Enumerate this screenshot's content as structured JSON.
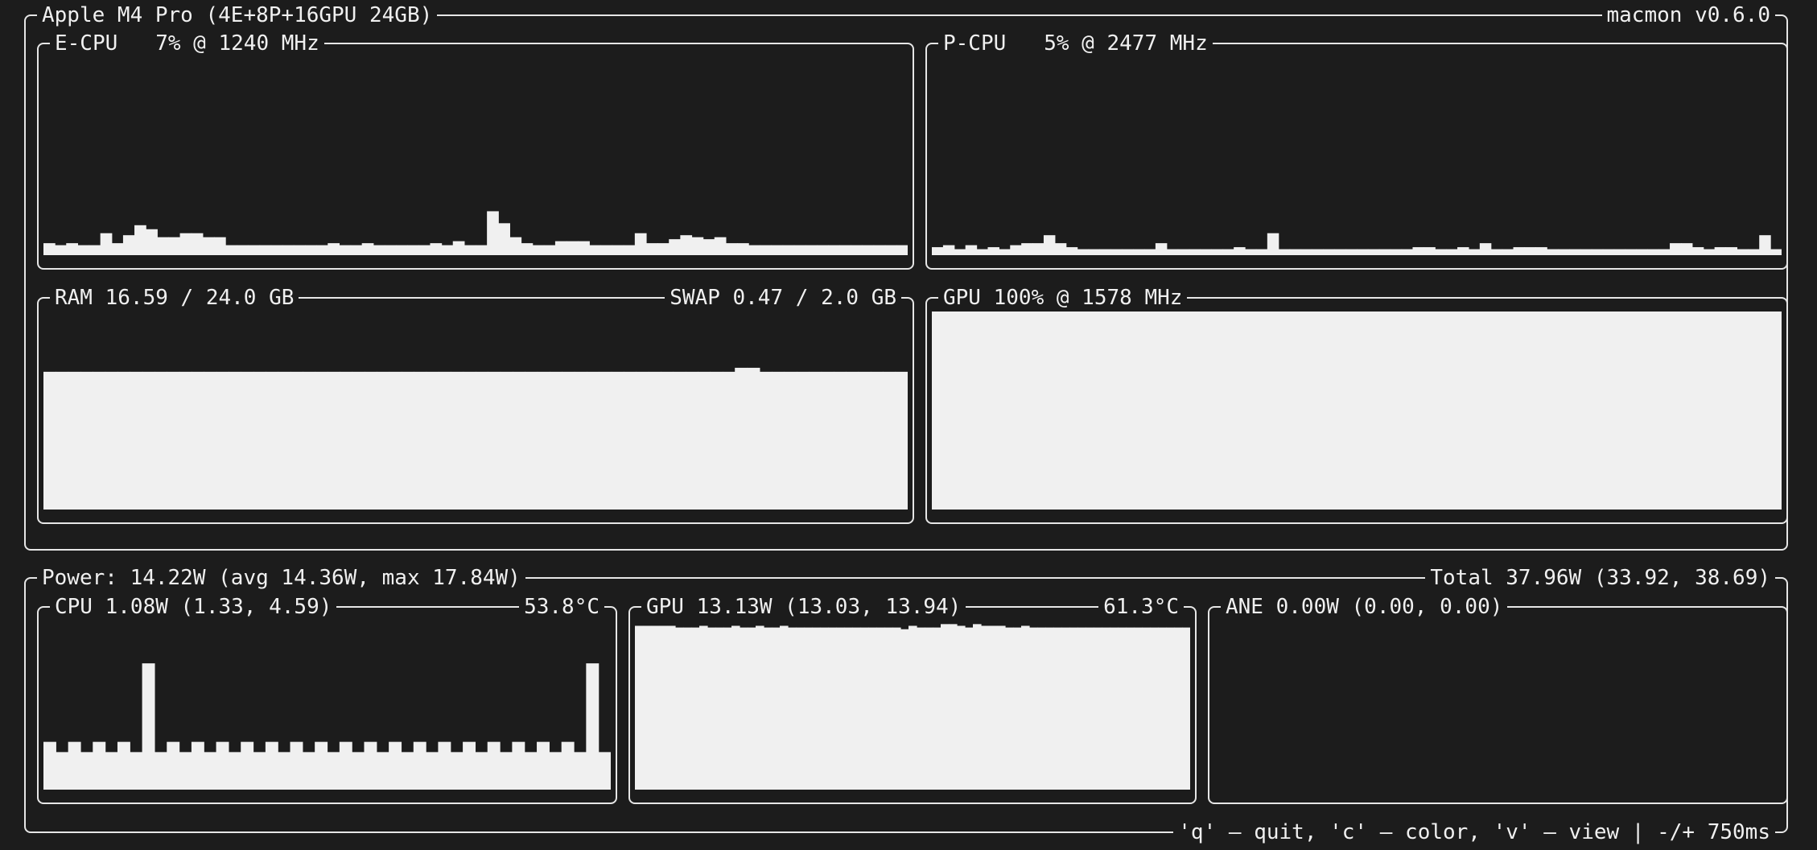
{
  "system": {
    "title": "Apple M4 Pro (4E+8P+16GPU 24GB)",
    "version": "macmon v0.6.0"
  },
  "ecpu": {
    "label": "E-CPU   7% @ 1240 MHz",
    "values": [
      6,
      5,
      6,
      5,
      5,
      11,
      6,
      10,
      15,
      13,
      9,
      9,
      11,
      11,
      9,
      9,
      5,
      5,
      5,
      5,
      5,
      5,
      5,
      5,
      5,
      6,
      5,
      5,
      6,
      5,
      5,
      5,
      5,
      5,
      6,
      5,
      7,
      5,
      5,
      22,
      16,
      9,
      6,
      5,
      5,
      7,
      7,
      7,
      5,
      5,
      5,
      5,
      11,
      6,
      6,
      8,
      10,
      9,
      8,
      9,
      6,
      6,
      5,
      5,
      5,
      5,
      5,
      5,
      5,
      5,
      5,
      5,
      5,
      5,
      5,
      5
    ]
  },
  "pcpu": {
    "label": "P-CPU   5% @ 2477 MHz",
    "values": [
      4,
      5,
      3,
      5,
      3,
      4,
      3,
      5,
      6,
      6,
      10,
      6,
      4,
      3,
      3,
      3,
      3,
      3,
      3,
      3,
      6,
      3,
      3,
      3,
      3,
      3,
      3,
      4,
      3,
      3,
      11,
      3,
      3,
      3,
      3,
      3,
      3,
      3,
      3,
      3,
      3,
      3,
      3,
      4,
      4,
      3,
      3,
      4,
      3,
      6,
      3,
      3,
      4,
      4,
      4,
      3,
      3,
      3,
      3,
      3,
      3,
      3,
      3,
      3,
      3,
      3,
      6,
      6,
      4,
      3,
      4,
      4,
      3,
      3,
      10,
      3
    ]
  },
  "ram": {
    "label": "RAM 16.59 / 24.0 GB",
    "swap_label": "SWAP 0.47 / 2.0 GB",
    "values": [
      69,
      69,
      69,
      69,
      69,
      69,
      69,
      69,
      69,
      69,
      69,
      69,
      69,
      69,
      69,
      69,
      69,
      69,
      69,
      69,
      69,
      69,
      69,
      69,
      69,
      69,
      69,
      69,
      69,
      69,
      69,
      69,
      69,
      69,
      69,
      69,
      69,
      69,
      69,
      69,
      69,
      69,
      69,
      69,
      69,
      69,
      69,
      69,
      69,
      69,
      69,
      69,
      69,
      69,
      69,
      69,
      71,
      71,
      69,
      69,
      69,
      69,
      69,
      69,
      69,
      69,
      69,
      69,
      69,
      69
    ]
  },
  "gpu": {
    "label": "GPU 100% @ 1578 MHz",
    "values": [
      100,
      100,
      100,
      100,
      100,
      100,
      100,
      100,
      100,
      100,
      100,
      100,
      100,
      100,
      100,
      100,
      100,
      100,
      100,
      100,
      100,
      100,
      100,
      100,
      100,
      100,
      100,
      100,
      100,
      100,
      100,
      100,
      100,
      100,
      100,
      100,
      100,
      100,
      100,
      100,
      100,
      100,
      100,
      100,
      100,
      100,
      100,
      100,
      100,
      100,
      100,
      100,
      100,
      100,
      100,
      100,
      100,
      100,
      100,
      100,
      100,
      100,
      100,
      100,
      100,
      100
    ]
  },
  "power": {
    "label": "Power: 14.22W (avg 14.36W, max 17.84W)",
    "total": "Total 37.96W (33.92, 38.69)",
    "footer": "'q' – quit, 'c' – color, 'v' – view | -/+ 750ms"
  },
  "cpu_power": {
    "label": "CPU 1.08W (1.33, 4.59)",
    "temp": "53.8°C",
    "values": [
      28,
      22,
      28,
      22,
      28,
      22,
      28,
      22,
      74,
      22,
      28,
      22,
      28,
      22,
      28,
      22,
      28,
      22,
      28,
      22,
      28,
      22,
      28,
      22,
      28,
      22,
      28,
      22,
      28,
      22,
      28,
      22,
      28,
      22,
      28,
      22,
      28,
      22,
      28,
      22,
      28,
      22,
      28,
      22,
      74,
      22
    ]
  },
  "gpu_power": {
    "label": "GPU 13.13W (13.03, 13.94)",
    "temp": "61.3°C",
    "values": [
      96,
      96,
      96,
      96,
      96,
      95,
      95,
      95,
      96,
      95,
      95,
      95,
      96,
      95,
      95,
      96,
      95,
      95,
      96,
      95,
      95,
      95,
      95,
      95,
      95,
      95,
      95,
      95,
      95,
      95,
      95,
      95,
      95,
      94,
      96,
      95,
      95,
      95,
      97,
      97,
      96,
      95,
      97,
      96,
      96,
      96,
      95,
      95,
      96,
      95,
      95,
      95,
      95,
      95,
      95,
      95,
      95,
      95,
      95,
      95,
      95,
      95,
      95,
      95,
      95,
      95,
      95,
      95,
      95
    ]
  },
  "ane_power": {
    "label": "ANE 0.00W (0.00, 0.00)",
    "values": []
  }
}
